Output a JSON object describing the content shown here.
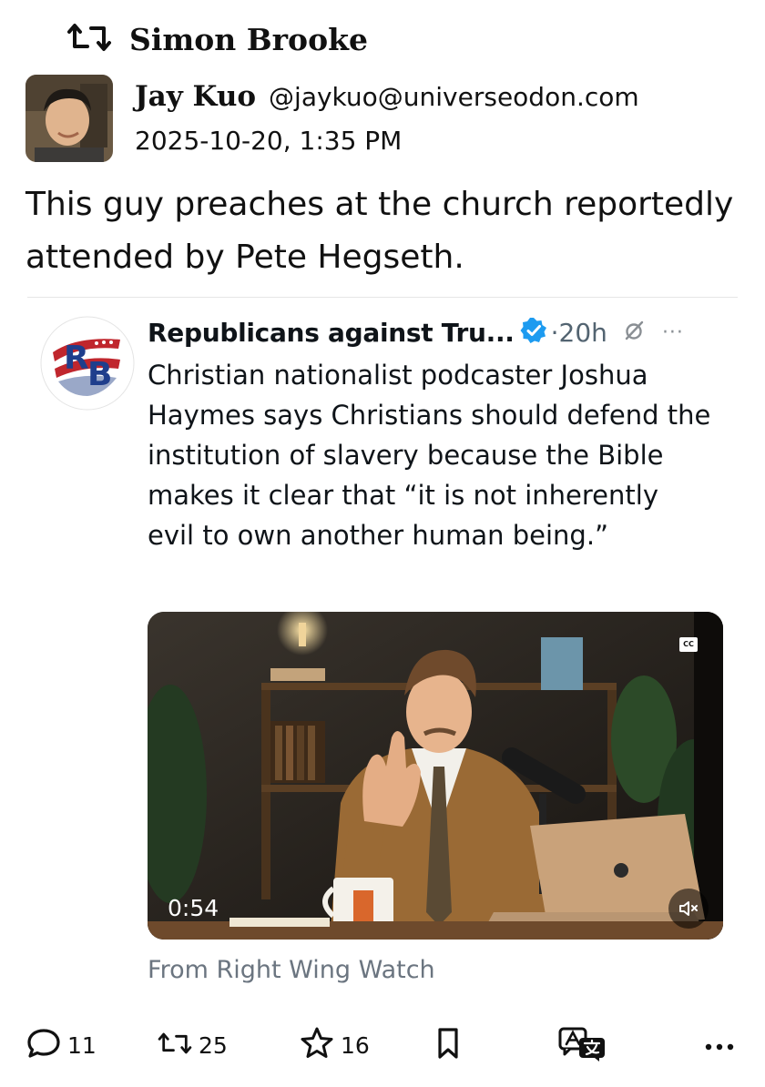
{
  "boost": {
    "icon": "boost-icon",
    "booster_name": "Simon Brooke"
  },
  "post": {
    "author_name": "Jay Kuo",
    "author_handle": "@jaykuo@universeodon.com",
    "timestamp": "2025-10-20, 1:35 PM",
    "text": "This guy preaches at the church reportedly attended by Pete Hegseth."
  },
  "quoted": {
    "account_name": "Republicans against Tru...",
    "time": "·20h",
    "text": "Christian nationalist podcaster Joshua Haymes says Christians should defend the institution of slavery because the Bible makes it clear that “it is not inherently evil to own another human being.”",
    "video_duration": "0:54",
    "cc_label": "CC",
    "source": "From Right Wing Watch",
    "verified_color": "#1d9bf0"
  },
  "actions": {
    "replies": "11",
    "boosts": "25",
    "favourites": "16"
  },
  "colors": {
    "text": "#111111",
    "muted": "#6b7580",
    "accent_blue": "#1d9bf0"
  }
}
